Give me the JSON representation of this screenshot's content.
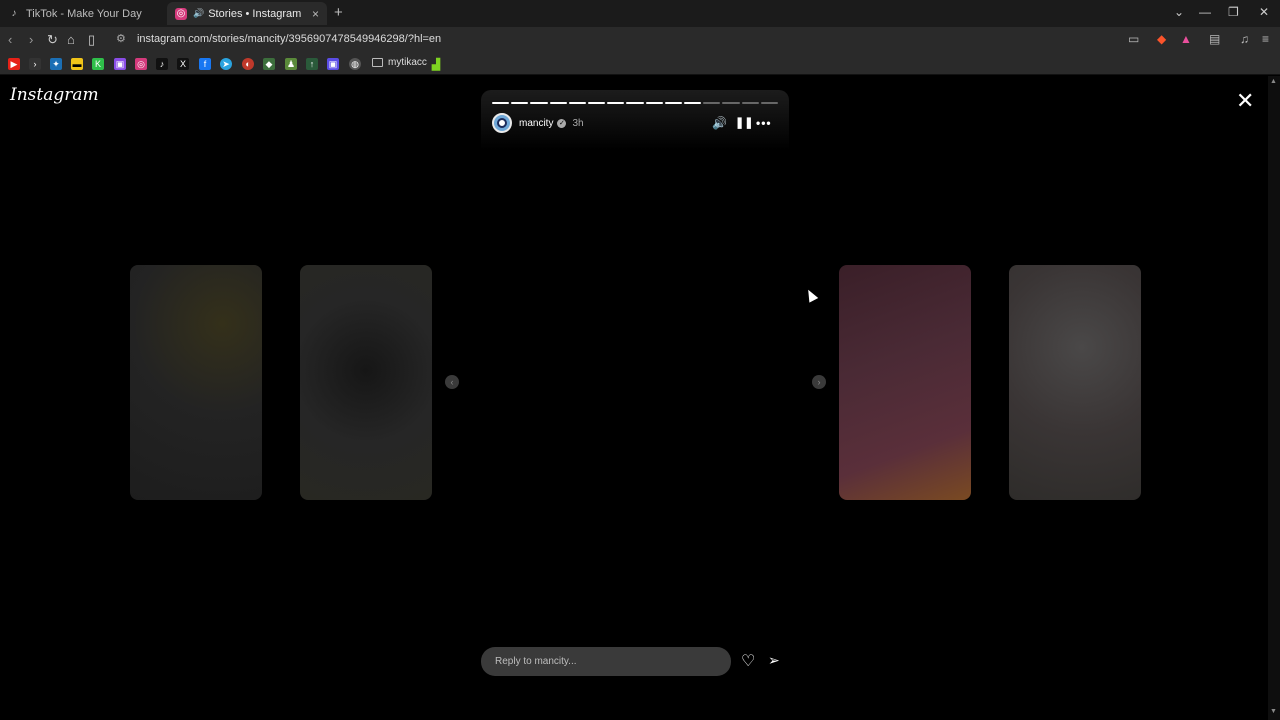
{
  "browser": {
    "tabs": [
      {
        "title": "TikTok - Make Your Day",
        "icon": "tiktok-icon"
      },
      {
        "title": "Stories • Instagram",
        "icon": "instagram-icon"
      }
    ],
    "url": "instagram.com/stories/mancity/3956907478549946298/?hl=en",
    "bookmark_folder": "mytikacc"
  },
  "instagram": {
    "logo": "Instagram",
    "story": {
      "username": "mancity",
      "age": "3h",
      "progress_segments_total": 15,
      "progress_segments_done": 11
    },
    "reply_placeholder": "Reply to mancity..."
  },
  "colors": {
    "bg": "#000000",
    "reply_bg": "#3a3a3a",
    "mancity_blue": "#6fa8d8"
  }
}
